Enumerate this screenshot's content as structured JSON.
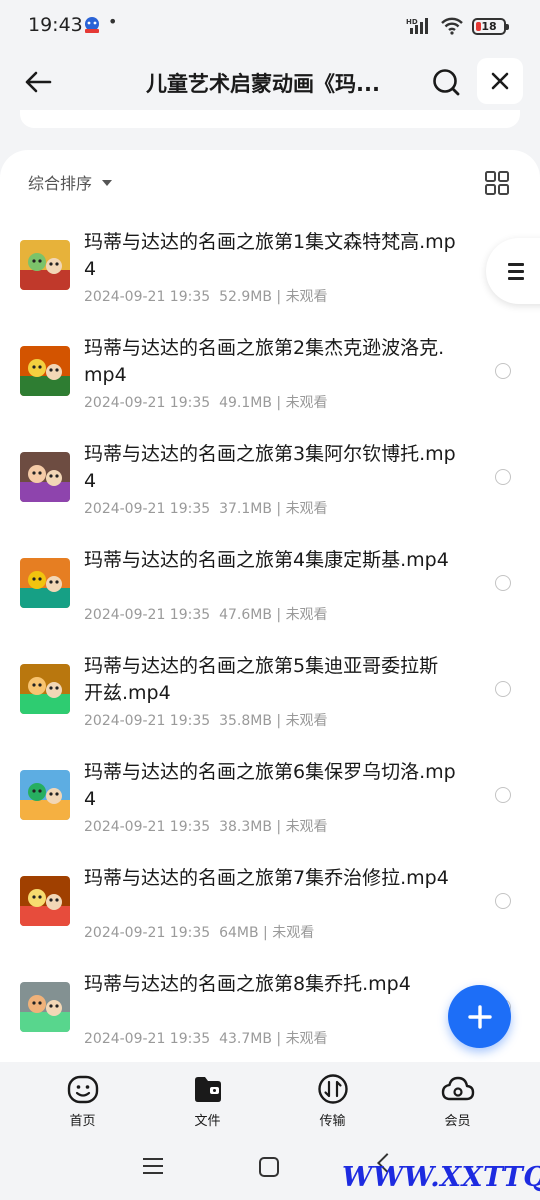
{
  "status_bar": {
    "time": "19:43",
    "dot": "•",
    "battery": "18",
    "app_icon": "baidu-bear-icon"
  },
  "header": {
    "title": "儿童艺术启蒙动画《玛...",
    "back_icon": "arrow-left-icon",
    "search_icon": "search-icon",
    "close_icon": "close-icon"
  },
  "sort": {
    "label": "综合排序",
    "grid_icon": "grid-view-icon"
  },
  "files": [
    {
      "name": "玛蒂与达达的名画之旅第1集文森特梵高.mp4",
      "date": "2024-09-21 19:35",
      "size": "52.9MB",
      "status": "未观看"
    },
    {
      "name": "玛蒂与达达的名画之旅第2集杰克逊波洛克.mp4",
      "date": "2024-09-21 19:35",
      "size": "49.1MB",
      "status": "未观看"
    },
    {
      "name": "玛蒂与达达的名画之旅第3集阿尔钦博托.mp4",
      "date": "2024-09-21 19:35",
      "size": "37.1MB",
      "status": "未观看"
    },
    {
      "name": "玛蒂与达达的名画之旅第4集康定斯基.mp4",
      "date": "2024-09-21 19:35",
      "size": "47.6MB",
      "status": "未观看"
    },
    {
      "name": "玛蒂与达达的名画之旅第5集迪亚哥委拉斯开兹.mp4",
      "date": "2024-09-21 19:35",
      "size": "35.8MB",
      "status": "未观看"
    },
    {
      "name": "玛蒂与达达的名画之旅第6集保罗乌切洛.mp4",
      "date": "2024-09-21 19:35",
      "size": "38.3MB",
      "status": "未观看"
    },
    {
      "name": "玛蒂与达达的名画之旅第7集乔治修拉.mp4",
      "date": "2024-09-21 19:35",
      "size": "64MB",
      "status": "未观看"
    },
    {
      "name": "玛蒂与达达的名画之旅第8集乔托.mp4",
      "date": "2024-09-21 19:35",
      "size": "43.7MB",
      "status": "未观看"
    }
  ],
  "meta_separator": "|",
  "bottom_nav": [
    {
      "label": "首页",
      "icon": "home-face-icon"
    },
    {
      "label": "文件",
      "icon": "folder-icon"
    },
    {
      "label": "传输",
      "icon": "transfer-icon"
    },
    {
      "label": "会员",
      "icon": "cloud-icon"
    }
  ],
  "fab_icon": "plus-icon",
  "watermark": "WWW.XXTTQ.COM",
  "colors": {
    "accent": "#1d6ef7",
    "background": "#f3f4f6",
    "battery_low": "#e53935"
  }
}
